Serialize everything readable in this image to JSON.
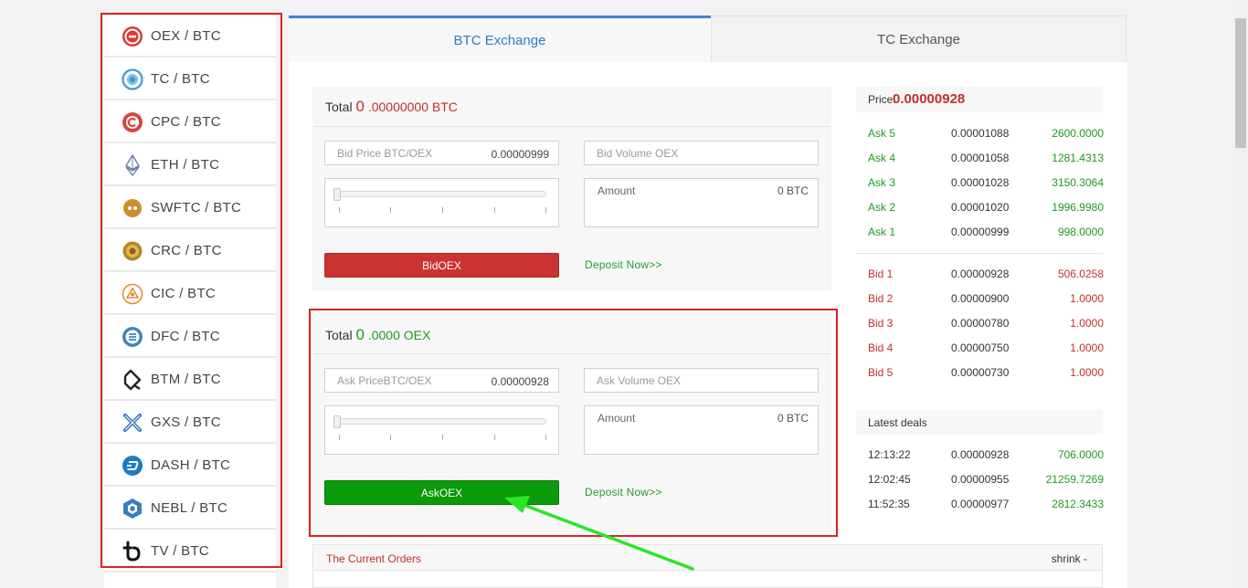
{
  "sidebar": {
    "items": [
      {
        "label": "OEX / BTC",
        "icon": "oex-coin-icon",
        "color": "#d93a36"
      },
      {
        "label": "TC / BTC",
        "icon": "tc-coin-icon",
        "color": "#3a9ad4"
      },
      {
        "label": "CPC / BTC",
        "icon": "cpc-coin-icon",
        "color": "#d9453e"
      },
      {
        "label": "ETH / BTC",
        "icon": "eth-coin-icon",
        "color": "#6a7fa6"
      },
      {
        "label": "SWFTC / BTC",
        "icon": "swftc-coin-icon",
        "color": "#c9912e"
      },
      {
        "label": "CRC / BTC",
        "icon": "crc-coin-icon",
        "color": "#b5852b"
      },
      {
        "label": "CIC / BTC",
        "icon": "cic-coin-icon",
        "color": "#e48a2c"
      },
      {
        "label": "DFC / BTC",
        "icon": "dfc-coin-icon",
        "color": "#3f86b8"
      },
      {
        "label": "BTM / BTC",
        "icon": "btm-coin-icon",
        "color": "#222222"
      },
      {
        "label": "GXS / BTC",
        "icon": "gxs-coin-icon",
        "color": "#2f6fbf"
      },
      {
        "label": "DASH / BTC",
        "icon": "dash-coin-icon",
        "color": "#1d7bc2"
      },
      {
        "label": "NEBL / BTC",
        "icon": "nebl-coin-icon",
        "color": "#3a7cc4"
      },
      {
        "label": "TV / BTC",
        "icon": "tv-coin-icon",
        "color": "#111111"
      }
    ]
  },
  "tabs": [
    {
      "label": "BTC Exchange",
      "active": true
    },
    {
      "label": "TC Exchange",
      "active": false
    }
  ],
  "bid": {
    "total_label": "Total",
    "total_int": "0",
    "total_dec": " .00000000 BTC",
    "price_placeholder": "Bid Price BTC/OEX",
    "price_value": "0.00000999",
    "volume_placeholder": "Bid Volume OEX",
    "slider_percent": 0,
    "amount_label": "Amount",
    "amount_value": "0 BTC",
    "button_label": "BidOEX",
    "deposit_label": "Deposit Now>>"
  },
  "ask": {
    "total_label": "Total",
    "total_int": "0",
    "total_dec": " .0000 OEX",
    "price_placeholder": "Ask PriceBTC/OEX",
    "price_value": "0.00000928",
    "volume_placeholder": "Ask Volume OEX",
    "slider_percent": 0,
    "amount_label": "Amount",
    "amount_value": "0 BTC",
    "button_label": "AskOEX",
    "deposit_label": "Deposit Now>>"
  },
  "orderbook": {
    "price_label": "Price:",
    "price_value": "0.00000928",
    "asks": [
      {
        "label": "Ask 5",
        "price": "0.00001088",
        "volume": "2600.0000"
      },
      {
        "label": "Ask 4",
        "price": "0.00001058",
        "volume": "1281.4313"
      },
      {
        "label": "Ask 3",
        "price": "0.00001028",
        "volume": "3150.3064"
      },
      {
        "label": "Ask 2",
        "price": "0.00001020",
        "volume": "1996.9980"
      },
      {
        "label": "Ask 1",
        "price": "0.00000999",
        "volume": "998.0000"
      }
    ],
    "bids": [
      {
        "label": "Bid 1",
        "price": "0.00000928",
        "volume": "506.0258"
      },
      {
        "label": "Bid 2",
        "price": "0.00000900",
        "volume": "1.0000"
      },
      {
        "label": "Bid 3",
        "price": "0.00000780",
        "volume": "1.0000"
      },
      {
        "label": "Bid 4",
        "price": "0.00000750",
        "volume": "1.0000"
      },
      {
        "label": "Bid 5",
        "price": "0.00000730",
        "volume": "1.0000"
      }
    ],
    "latest_label": "Latest deals",
    "deals": [
      {
        "time": "12:13:22",
        "price": "0.00000928",
        "volume": "706.0000"
      },
      {
        "time": "12:02:45",
        "price": "0.00000955",
        "volume": "21259.7269"
      },
      {
        "time": "11:52:35",
        "price": "0.00000977",
        "volume": "2812.3433"
      }
    ]
  },
  "orders": {
    "title": "The Current Orders",
    "shrink_label": "shrink -"
  },
  "colors": {
    "accent_blue": "#2f7bc9",
    "bid_red": "#cb3232",
    "ask_green": "#0a9a0a",
    "highlight_frame": "#e02020",
    "annotation_arrow": "#29e629"
  }
}
